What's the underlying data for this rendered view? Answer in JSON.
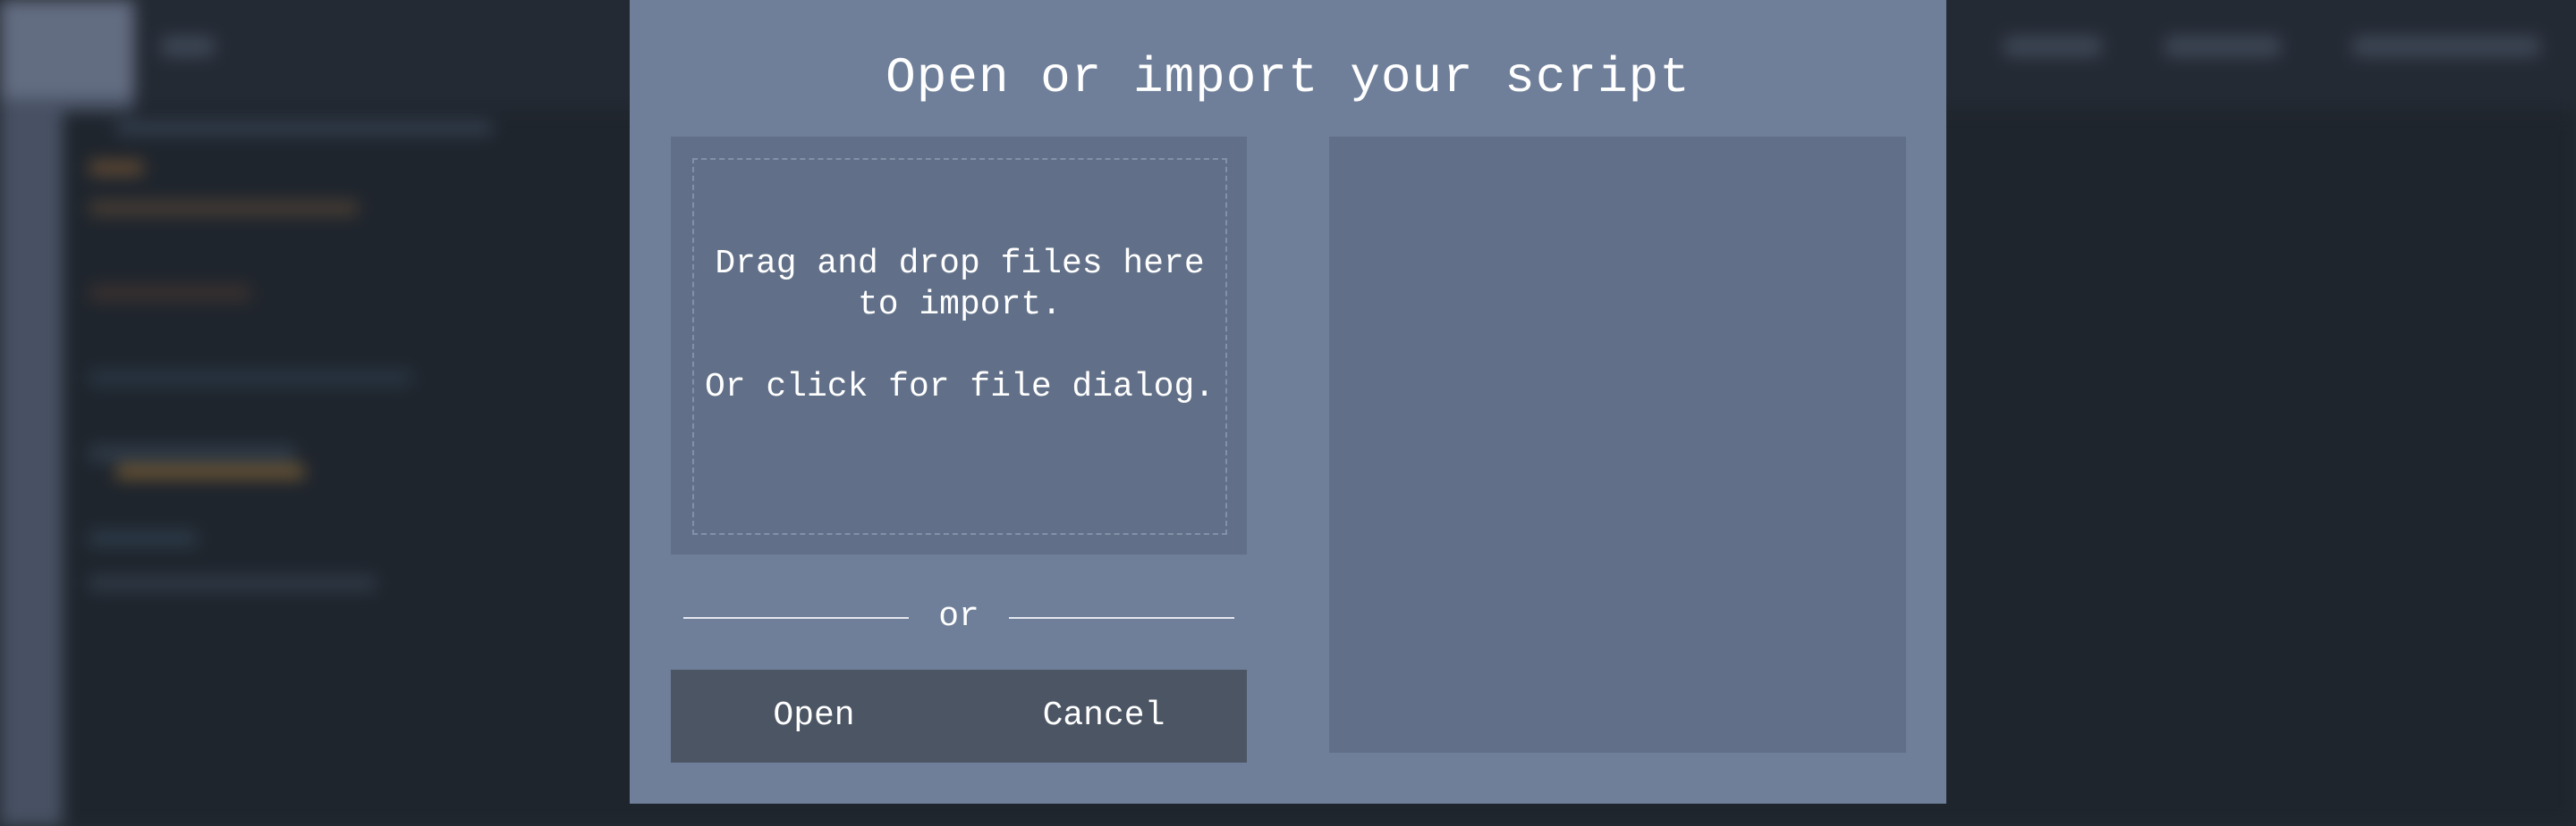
{
  "dialog": {
    "title": "Open or import your script",
    "dropzone": {
      "line1": "Drag and drop files here to import.",
      "line2": "Or click for file dialog."
    },
    "separator": "or",
    "buttons": {
      "open": "Open",
      "cancel": "Cancel"
    }
  },
  "colors": {
    "dialog_bg": "#6f7f99",
    "panel_bg": "#617088",
    "button_bar_bg": "#4b5564",
    "page_bg": "#252b33",
    "text": "#ffffff"
  }
}
